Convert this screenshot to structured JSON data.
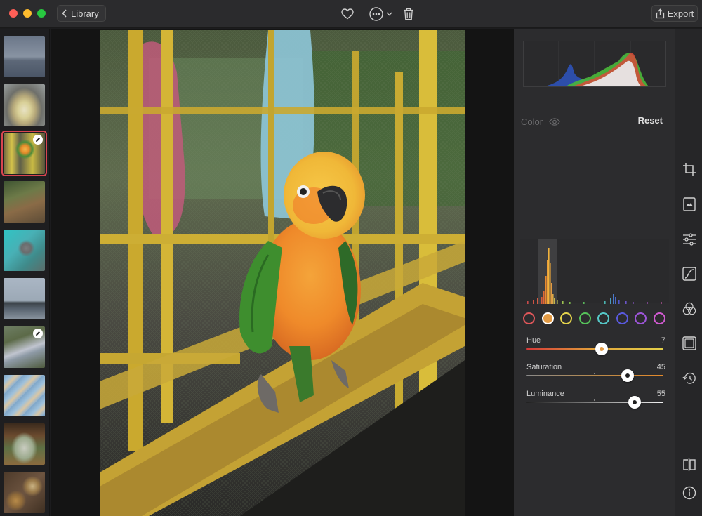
{
  "window": {
    "back_label": "Library",
    "export_label": "Export",
    "toolbar_icons": [
      "heart-icon",
      "more-icon",
      "trash-icon"
    ]
  },
  "filmstrip": {
    "thumbnails": [
      {
        "subject": "misty lake",
        "edited": false
      },
      {
        "subject": "cake",
        "edited": false
      },
      {
        "subject": "parrot in cage",
        "edited": true,
        "selected": true
      },
      {
        "subject": "birds on ground",
        "edited": false
      },
      {
        "subject": "pigeon",
        "edited": false
      },
      {
        "subject": "jetty at dusk",
        "edited": false
      },
      {
        "subject": "river stream",
        "edited": true
      },
      {
        "subject": "sticker sheet",
        "edited": false
      },
      {
        "subject": "landscape through arch",
        "edited": false
      },
      {
        "subject": "food platter",
        "edited": false
      }
    ]
  },
  "panel": {
    "section_label": "Color",
    "reset_label": "Reset",
    "swatches": [
      {
        "name": "red",
        "color": "#e0575a"
      },
      {
        "name": "orange",
        "color": "#e29a44",
        "active": true
      },
      {
        "name": "yellow",
        "color": "#e5d44c"
      },
      {
        "name": "green",
        "color": "#56c45a"
      },
      {
        "name": "aqua",
        "color": "#56c8c8"
      },
      {
        "name": "blue",
        "color": "#5a5ae0"
      },
      {
        "name": "purple",
        "color": "#9d55d8"
      },
      {
        "name": "magenta",
        "color": "#d05ad0"
      }
    ],
    "sliders": [
      {
        "label": "Hue",
        "value": "7",
        "position": 0.55
      },
      {
        "label": "Saturation",
        "value": "45",
        "position": 0.74
      },
      {
        "label": "Luminance",
        "value": "55",
        "position": 0.79
      }
    ]
  },
  "rail": {
    "icons": [
      "crop-icon",
      "presets-icon",
      "adjust-icon",
      "curves-icon",
      "color-icon",
      "vignette-icon",
      "history-icon",
      "compare-icon",
      "info-icon"
    ]
  }
}
